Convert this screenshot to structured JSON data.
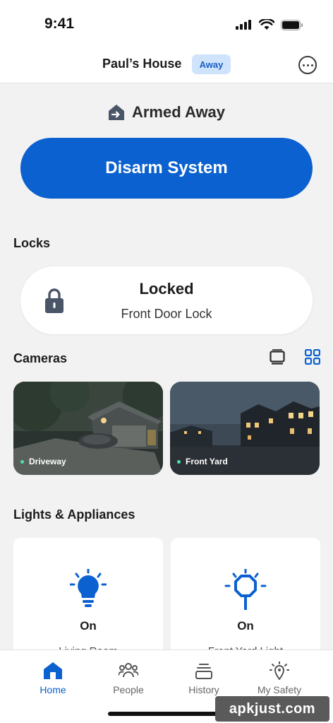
{
  "status_bar": {
    "time": "9:41"
  },
  "header": {
    "house_name": "Paul’s House",
    "mode_badge": "Away"
  },
  "security": {
    "state_label": "Armed Away",
    "action_label": "Disarm System"
  },
  "locks": {
    "title": "Locks",
    "items": [
      {
        "status": "Locked",
        "name": "Front Door Lock"
      }
    ]
  },
  "cameras": {
    "title": "Cameras",
    "items": [
      {
        "name": "Driveway"
      },
      {
        "name": "Front Yard"
      }
    ]
  },
  "lights": {
    "title": "Lights & Appliances",
    "items": [
      {
        "status": "On",
        "name": "Living Room",
        "icon": "lightbulb-icon"
      },
      {
        "status": "On",
        "name": "Front Yard Light",
        "icon": "outdoor-light-icon"
      }
    ]
  },
  "tabs": [
    {
      "label": "Home",
      "icon": "home-icon",
      "active": true
    },
    {
      "label": "People",
      "icon": "people-icon",
      "active": false
    },
    {
      "label": "History",
      "icon": "history-icon",
      "active": false
    },
    {
      "label": "My Safety",
      "icon": "safety-icon",
      "active": false
    }
  ],
  "watermark": "apkjust.com",
  "colors": {
    "accent": "#0b61cf",
    "badge_bg": "#cfe3fb",
    "live_dot": "#4fe0b0"
  }
}
